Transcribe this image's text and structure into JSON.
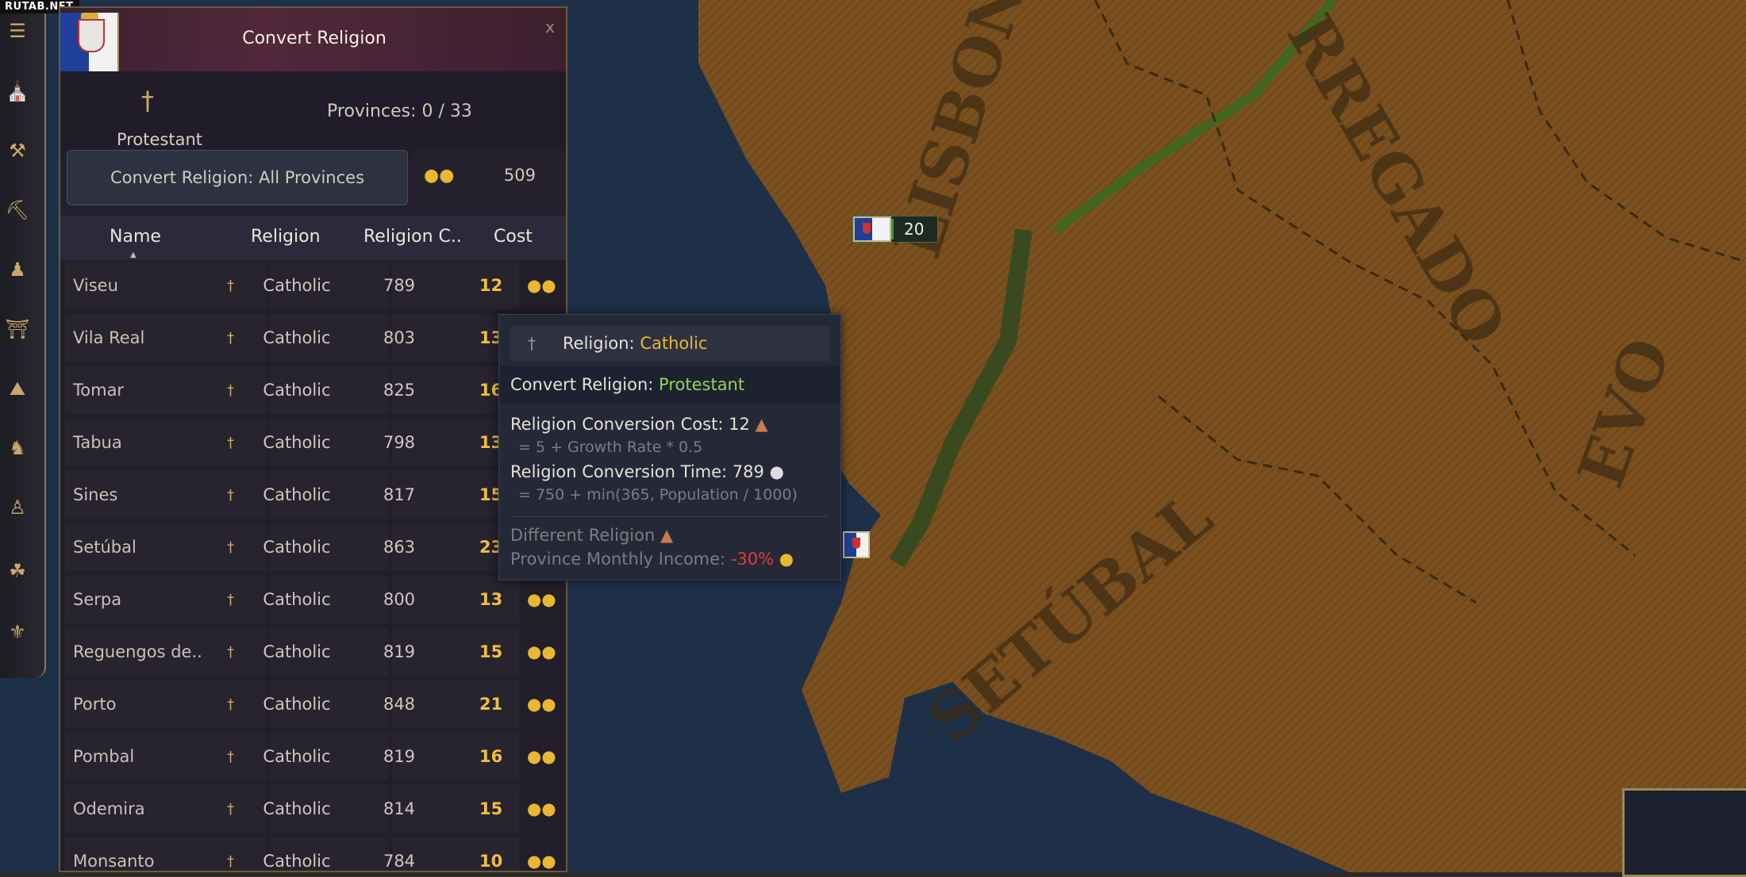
{
  "watermark": "RUTAB.NET",
  "window": {
    "title": "Convert Religion",
    "close_label": "x"
  },
  "target_religion": {
    "name": "Protestant",
    "icon": "cross-icon"
  },
  "provinces_label": "Provinces: 0 / 33",
  "convert_all": {
    "label": "Convert Religion: All Provinces",
    "cost": "509"
  },
  "columns": [
    "Name",
    "Religion",
    "Religion C..",
    "Cost"
  ],
  "rows": [
    {
      "name": "Viseu",
      "religion": "Catholic",
      "time": "789",
      "cost": "12"
    },
    {
      "name": "Vila Real",
      "religion": "Catholic",
      "time": "803",
      "cost": "13"
    },
    {
      "name": "Tomar",
      "religion": "Catholic",
      "time": "825",
      "cost": "16"
    },
    {
      "name": "Tabua",
      "religion": "Catholic",
      "time": "798",
      "cost": "13"
    },
    {
      "name": "Sines",
      "religion": "Catholic",
      "time": "817",
      "cost": "15"
    },
    {
      "name": "Setúbal",
      "religion": "Catholic",
      "time": "863",
      "cost": "23"
    },
    {
      "name": "Serpa",
      "religion": "Catholic",
      "time": "800",
      "cost": "13"
    },
    {
      "name": "Reguengos de..",
      "religion": "Catholic",
      "time": "819",
      "cost": "15"
    },
    {
      "name": "Porto",
      "religion": "Catholic",
      "time": "848",
      "cost": "21"
    },
    {
      "name": "Pombal",
      "religion": "Catholic",
      "time": "819",
      "cost": "16"
    },
    {
      "name": "Odemira",
      "religion": "Catholic",
      "time": "814",
      "cost": "15"
    },
    {
      "name": "Monsanto",
      "religion": "Catholic",
      "time": "784",
      "cost": "10"
    }
  ],
  "tooltip": {
    "religion_label": "Religion:",
    "religion_value": "Catholic",
    "convert_label": "Convert Religion:",
    "convert_value": "Protestant",
    "cost_line": "Religion Conversion Cost: 12",
    "cost_formula": "= 5 + Growth Rate * 0.5",
    "time_line": "Religion Conversion Time: 789",
    "time_formula": "= 750 + min(365, Population / 1000)",
    "diff_label": "Different Religion",
    "income_label": "Province Monthly Income:",
    "income_value": "-30%"
  },
  "map": {
    "labels": [
      "LISBON",
      "RREGADO",
      "SETÚBAL",
      "EVO"
    ],
    "army_size": "20"
  },
  "colors": {
    "panel_bg": "#231f2c",
    "header_bg": "#52283a",
    "gold": "#e8b830",
    "accent_green": "#9ad15a",
    "negative": "#e83838",
    "map_land": "#7a5020",
    "sea": "#1e2f48"
  }
}
